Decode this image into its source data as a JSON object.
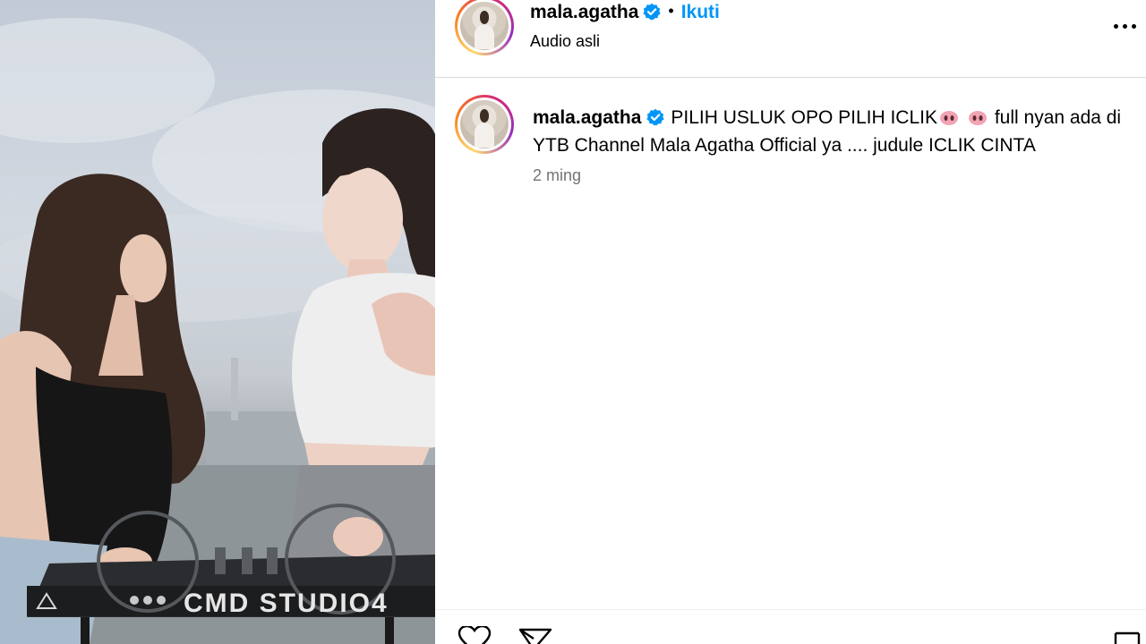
{
  "post": {
    "username": "mala.agatha",
    "follow_label": "Ikuti",
    "separator": "•",
    "audio_label": "Audio asli"
  },
  "caption": {
    "username": "mala.agatha",
    "text_part1": "PILIH USLUK OPO PILIH ICLIK",
    "text_part2": " full nyan ada di YTB Channel Mala Agatha Official ya .... judule ICLIK CINTA",
    "emoji": "pig-nose-emoji",
    "timestamp": "2 ming"
  },
  "media": {
    "device_label": "CMD STUDIO4"
  },
  "colors": {
    "accent": "#0095f6",
    "verified": "#0095f6",
    "muted": "#737373",
    "divider": "#dbdbdb"
  },
  "icons": {
    "verified": "verified-badge-icon",
    "more": "more-options-icon",
    "like": "heart-icon",
    "share": "share-icon",
    "save": "bookmark-icon"
  }
}
